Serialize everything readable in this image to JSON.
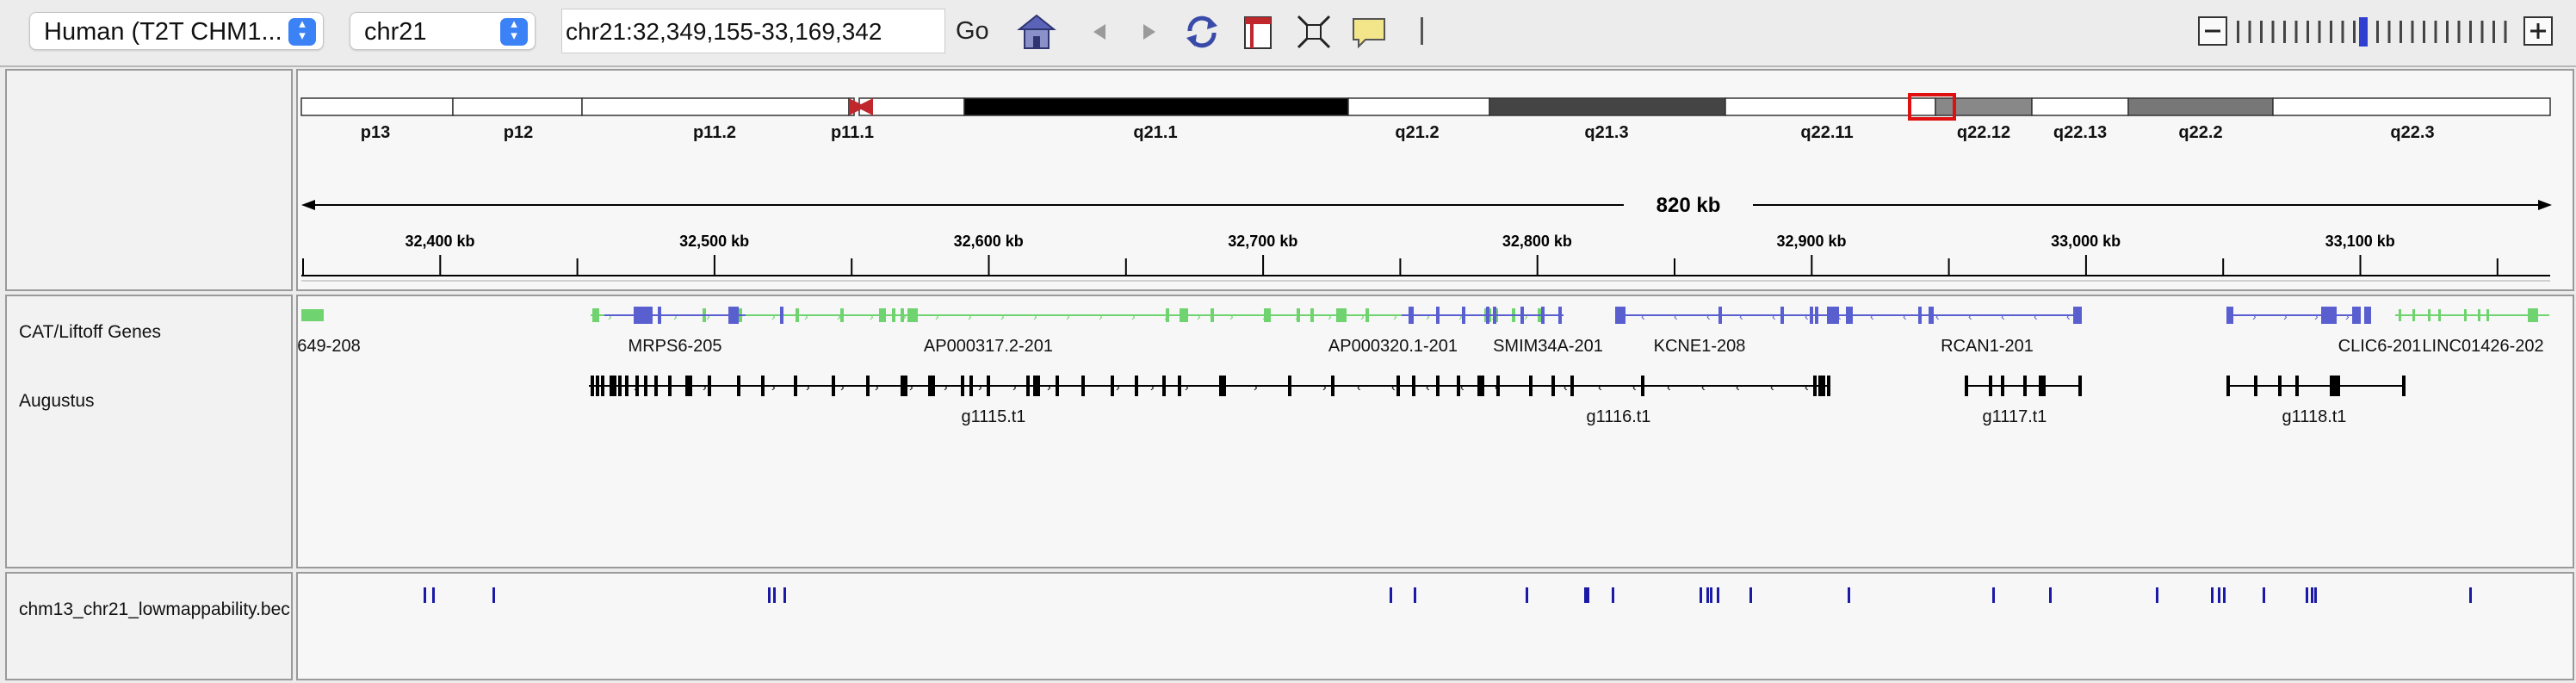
{
  "toolbar": {
    "genome": "Human (T2T CHM1...",
    "chromosome": "chr21",
    "locus": "chr21:32,349,155-33,169,342",
    "go_label": "Go"
  },
  "ideogram": {
    "bands": [
      "p13",
      "p12",
      "p11.2",
      "p11.1",
      "q21.1",
      "q21.2",
      "q21.3",
      "q22.11",
      "q22.12",
      "q22.13",
      "q22.2",
      "q22.3"
    ]
  },
  "ruler": {
    "span_label": "820 kb",
    "ticks": [
      "32,400 kb",
      "32,500 kb",
      "32,600 kb",
      "32,700 kb",
      "32,800 kb",
      "32,900 kb",
      "33,000 kb",
      "33,100 kb"
    ]
  },
  "tracks": {
    "genes_label": "CAT/Liftoff Genes",
    "augustus_label": "Augustus",
    "lowmap_label": "chm13_chr21_lowmappability.bec"
  },
  "gene_names": [
    "649-208",
    "MRPS6-205",
    "AP000317.2-201",
    "AP000320.1-201",
    "SMIM34A-201",
    "KCNE1-208",
    "RCAN1-201",
    "CLIC6-201",
    "LINC01426-202"
  ],
  "augustus_names": [
    "g1115.t1",
    "g1116.t1",
    "g1117.t1",
    "g1118.t1"
  ],
  "colors": {
    "gene_green": "#6fd36f",
    "gene_blue": "#5a5fd0",
    "augustus": "#000000",
    "lowmap": "#1a1aa6",
    "highlight": "#e01010"
  }
}
